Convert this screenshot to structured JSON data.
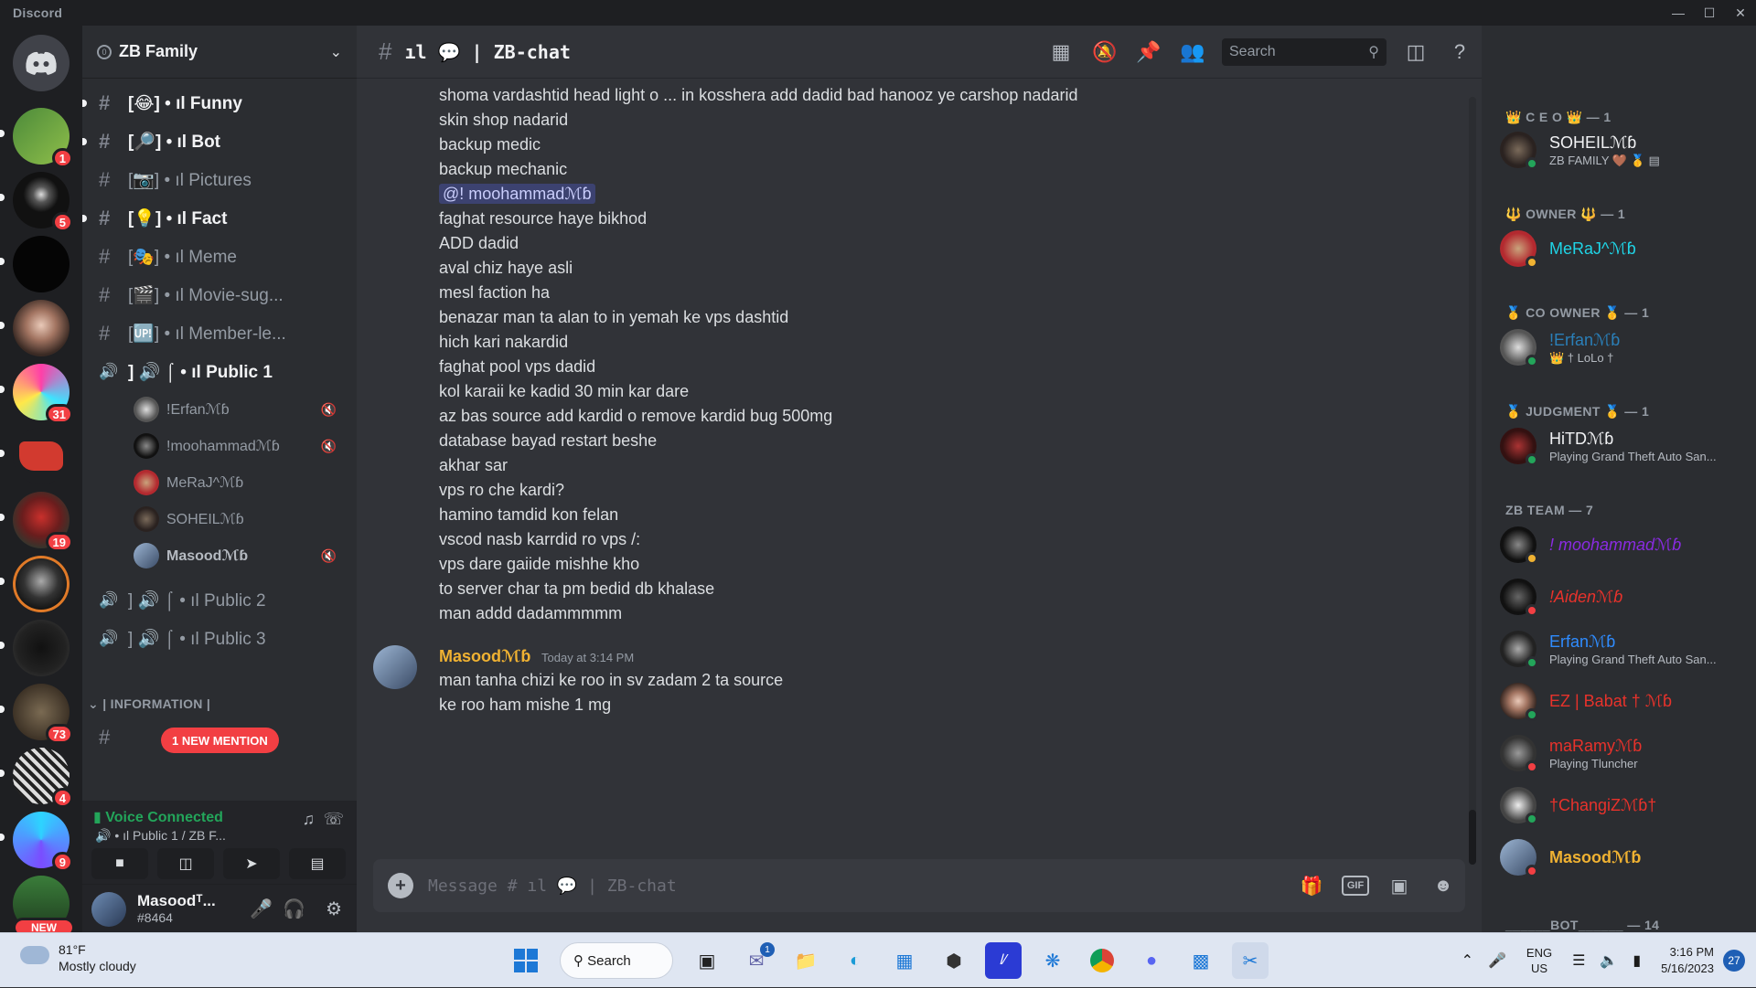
{
  "window": {
    "app_name": "Discord"
  },
  "rail": {
    "badges": [
      "1",
      "5",
      "31",
      "19",
      "73",
      "4",
      "9"
    ],
    "new_label": "NEW"
  },
  "server": {
    "name": "ZB Family",
    "boost_level": "0"
  },
  "channels": [
    {
      "label": "[😂] • ıl Funny"
    },
    {
      "label": "[🔎] • ıl Bot"
    },
    {
      "label": "[📷] • ıl Pictures"
    },
    {
      "label": "[💡] • ıl Fact"
    },
    {
      "label": "[🎭] • ıl Meme"
    },
    {
      "label": "[🎬] • ıl Movie-sug..."
    },
    {
      "label": "[🆙] • ıl Member-le..."
    },
    {
      "label": "] 🔊 ⌠ • ıl Public 1"
    },
    {
      "label": "] 🔊 ⌠ • ıl Public 2"
    },
    {
      "label": "] 🔊 ⌠ • ıl Public 3"
    }
  ],
  "voice_users": [
    "!Erfanℳɓ",
    "!moohammadℳɓ",
    "MeRaJ^ℳɓ",
    "SOHEILℳɓ",
    "Masoodℳɓ"
  ],
  "category": "| INFORMATION |",
  "new_mention": "1 NEW MENTION",
  "voice": {
    "status": "Voice Connected",
    "channel": "🔊 • ıl Public 1 / ZB F..."
  },
  "user": {
    "name": "Masoodᵀ...",
    "tag": "#8464"
  },
  "header": {
    "channel": "ıl 💬 | ZB-chat",
    "search_placeholder": "Search"
  },
  "messages": {
    "continuation": [
      "shoma vardashtid head light o ... in kosshera add dadid bad hanooz ye carshop nadarid",
      "skin shop nadarid",
      "backup medic",
      "backup mechanic",
      "@!    moohammadℳɓ",
      "faghat resource haye bikhod",
      "ADD dadid",
      "aval chiz haye asli",
      "mesl faction ha",
      "benazar man ta alan to in yemah ke vps dashtid",
      "hich kari nakardid",
      "faghat pool vps dadid",
      "kol karaii ke kadid 30 min kar dare",
      "az bas source add kardid o remove kardid bug 500mg",
      "database bayad restart beshe",
      "akhar sar",
      "vps ro che kardi?",
      "hamino tamdid kon felan",
      "vscod nasb karrdid ro vps /:",
      "vps dare gaiide mishhe kho",
      "to server char ta pm bedid db khalase",
      "man addd dadammmmm"
    ],
    "group": {
      "author": "Masoodℳɓ",
      "timestamp": "Today at 3:14 PM",
      "lines": [
        "man tanha chizi ke roo in sv zadam 2 ta source",
        "ke roo ham mishe 1 mg"
      ]
    }
  },
  "composer": {
    "placeholder": "Message # ıl 💬 | ZB-chat",
    "gif_label": "GIF"
  },
  "members": {
    "roles": [
      {
        "title": "👑 C E O 👑 — 1"
      },
      {
        "title": "🔱 OWNER 🔱 — 1"
      },
      {
        "title": "🥇 CO OWNER 🥇 — 1"
      },
      {
        "title": "🥇 JUDGMENT 🥇 — 1"
      },
      {
        "title": "ZB TEAM — 7"
      },
      {
        "title": "______BOT______ — 14"
      }
    ],
    "list": [
      {
        "name": "SOHEILℳɓ",
        "sub": "ZB FAMILY 🤎 🥇 ▤",
        "color": "#f2f3f5"
      },
      {
        "name": "MeRaJ^ℳɓ",
        "sub": "",
        "color": "#1fd4e6"
      },
      {
        "name": "!Erfanℳɓ",
        "sub": "👑 † LoLo †",
        "color": "#2a7fb8"
      },
      {
        "name": "HiTDℳɓ",
        "sub": "Playing Grand Theft Auto San...",
        "color": "#f2f3f5"
      },
      {
        "name": "! moohammadℳɓ",
        "sub": "",
        "color": "#8a2be2"
      },
      {
        "name": "!Aidenℳɓ",
        "sub": "",
        "color": "#e8322b"
      },
      {
        "name": "Erfanℳɓ",
        "sub": "Playing Grand Theft Auto San...",
        "color": "#2f8cff"
      },
      {
        "name": "EZ | Babat † ℳɓ",
        "sub": "",
        "color": "#e8322b"
      },
      {
        "name": "maRamyℳɓ",
        "sub": "Playing Tluncher",
        "color": "#e8322b"
      },
      {
        "name": "†ChangiZℳɓ†",
        "sub": "",
        "color": "#e8322b"
      },
      {
        "name": "Masoodℳɓ",
        "sub": "",
        "color": "#f0b232"
      }
    ]
  },
  "taskbar": {
    "temp": "81°F",
    "weather": "Mostly cloudy",
    "search": "Search",
    "lang1": "ENG",
    "lang2": "US",
    "time": "3:16 PM",
    "date": "5/16/2023",
    "notifications": "27",
    "teams_badge": "1"
  }
}
